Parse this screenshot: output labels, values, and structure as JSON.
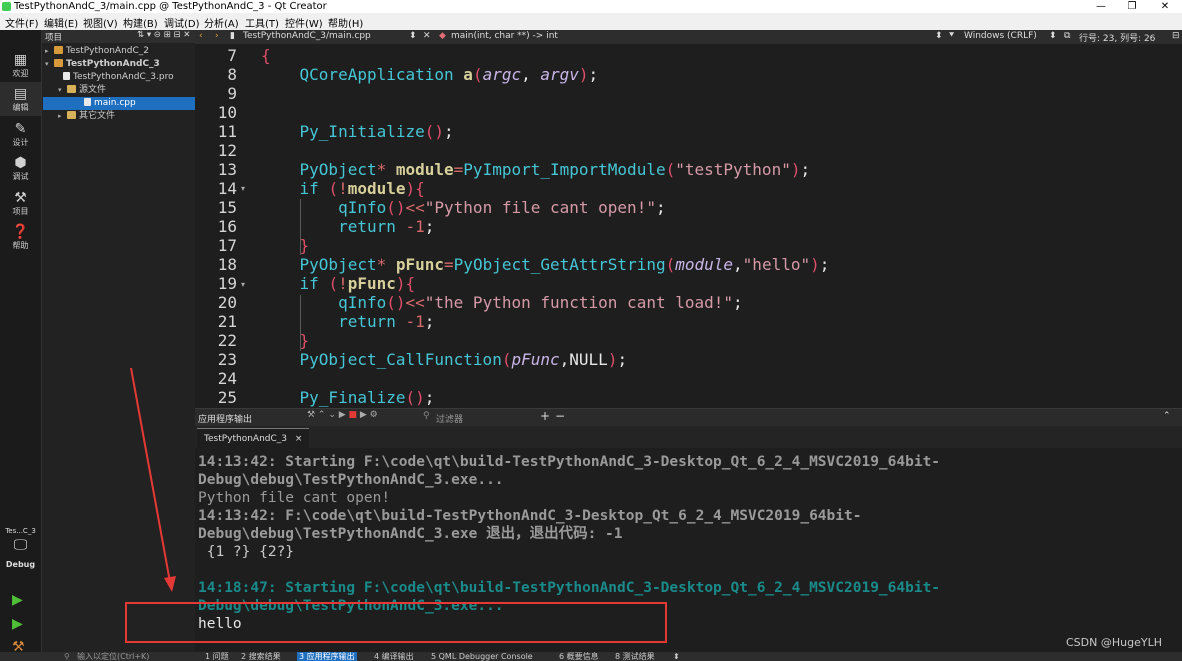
{
  "window": {
    "title": "TestPythonAndC_3/main.cpp @ TestPythonAndC_3 - Qt Creator",
    "minimize": "—",
    "maximize": "❐",
    "close": "✕"
  },
  "menu": [
    "文件(F)",
    "编辑(E)",
    "视图(V)",
    "构建(B)",
    "调试(D)",
    "分析(A)",
    "工具(T)",
    "控件(W)",
    "帮助(H)"
  ],
  "modes": [
    {
      "label": "欢迎",
      "icon": "grid-icon"
    },
    {
      "label": "编辑",
      "icon": "edit-icon"
    },
    {
      "label": "设计",
      "icon": "pencil-icon"
    },
    {
      "label": "调试",
      "icon": "bug-icon"
    },
    {
      "label": "项目",
      "icon": "wrench-icon"
    },
    {
      "label": "帮助",
      "icon": "help-icon"
    }
  ],
  "kit": {
    "project": "Tes...C_3",
    "config": "Debug"
  },
  "tree": {
    "header": "项目",
    "nodes": [
      "TestPythonAndC_2",
      "TestPythonAndC_3",
      "TestPythonAndC_3.pro",
      "源文件",
      "main.cpp",
      "其它文件"
    ]
  },
  "editor": {
    "file": "TestPythonAndC_3/main.cpp",
    "function": "main(int, char **) -> int",
    "encoding": "Windows (CRLF)",
    "position": "行号: 23, 列号: 26",
    "line_numbers": [
      "7",
      "8",
      "9",
      "10",
      "11",
      "12",
      "13",
      "14",
      "15",
      "16",
      "17",
      "18",
      "19",
      "20",
      "21",
      "22",
      "23",
      "24",
      "25"
    ]
  },
  "output": {
    "pane_title": "应用程序输出",
    "filter_placeholder": "过滤器",
    "tab": "TestPythonAndC_3",
    "tab_close": "×",
    "lines": [
      "14:13:42: Starting F:\\code\\qt\\build-TestPythonAndC_3-Desktop_Qt_6_2_4_MSVC2019_64bit-",
      "Debug\\debug\\TestPythonAndC_3.exe...",
      "Python file cant open!",
      "14:13:42: F:\\code\\qt\\build-TestPythonAndC_3-Desktop_Qt_6_2_4_MSVC2019_64bit-",
      "Debug\\debug\\TestPythonAndC_3.exe 退出，退出代码: -1",
      " {1 ?} {2?}",
      "",
      "14:18:47: Starting F:\\code\\qt\\build-TestPythonAndC_3-Desktop_Qt_6_2_4_MSVC2019_64bit-",
      "Debug\\debug\\TestPythonAndC_3.exe...",
      "hello"
    ]
  },
  "status": {
    "locator": "输入以定位(Ctrl+K)",
    "tabs": [
      "1 问题",
      "2 搜索结果",
      "3 应用程序输出",
      "4 编译输出",
      "5 QML Debugger Console",
      "6 概要信息",
      "8 测试结果"
    ]
  },
  "watermark": "CSDN @HugeYLH",
  "colors": {
    "accent": "#1f6fc0",
    "annotation": "#e53935",
    "keyword": "#45c6d6",
    "function": "#d6cf9a",
    "string": "#d69aa7"
  }
}
